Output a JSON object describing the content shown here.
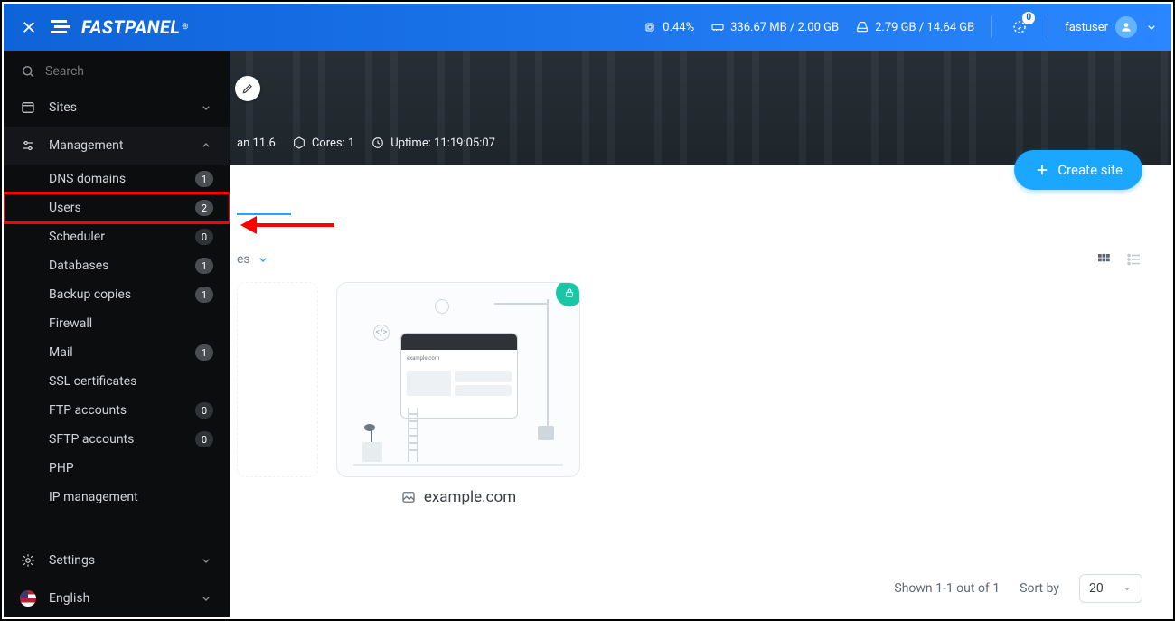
{
  "brand": {
    "name": "FASTPANEL",
    "trademark": "®"
  },
  "topbar": {
    "cpu_percent": "0.44%",
    "ram": "336.67 MB / 2.00 GB",
    "disk": "2.79 GB / 14.64 GB",
    "notif_count": "0",
    "username": "fastuser"
  },
  "sidebar": {
    "search_placeholder": "Search",
    "sites_label": "Sites",
    "management_label": "Management",
    "sub": {
      "dns": {
        "label": "DNS domains",
        "count": "1"
      },
      "users": {
        "label": "Users",
        "count": "2"
      },
      "scheduler": {
        "label": "Scheduler",
        "count": "0"
      },
      "databases": {
        "label": "Databases",
        "count": "1"
      },
      "backup": {
        "label": "Backup copies",
        "count": "1"
      },
      "firewall": {
        "label": "Firewall"
      },
      "mail": {
        "label": "Mail",
        "count": "1"
      },
      "ssl": {
        "label": "SSL certificates"
      },
      "ftp": {
        "label": "FTP accounts",
        "count": "0"
      },
      "sftp": {
        "label": "SFTP accounts",
        "count": "0"
      },
      "php": {
        "label": "PHP"
      },
      "ip": {
        "label": "IP management"
      }
    },
    "settings_label": "Settings",
    "language_label": "English"
  },
  "hero": {
    "os_fragment": "an 11.6",
    "cores": "Cores: 1",
    "uptime": "Uptime: 11:19:05:07"
  },
  "main": {
    "create_site": "Create site",
    "filter_fragment": "es",
    "site_domain": "example.com",
    "site_thumb_url_text": "example.com"
  },
  "footer": {
    "shown": "Shown 1-1 out of 1",
    "sort_by": "Sort by",
    "page_size": "20"
  }
}
